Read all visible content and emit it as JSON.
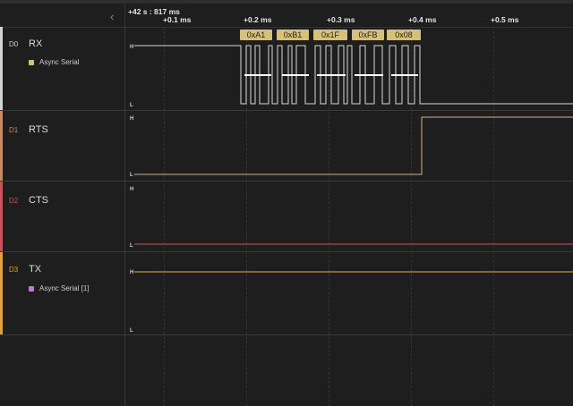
{
  "timeline": {
    "origin": "+42 s : 817 ms",
    "ticks": [
      "+0.1 ms",
      "+0.2 ms",
      "+0.3 ms",
      "+0.4 ms",
      "+0.5 ms"
    ]
  },
  "level_labels": {
    "high": "H",
    "low": "L"
  },
  "channels": [
    {
      "num": "D0",
      "name": "RX",
      "color": "#d4d4d4",
      "analyzer": "Async Serial",
      "analyzer_color": "#d5c07c",
      "decoded": [
        "0xA1",
        "0xB1",
        "0x1F",
        "0xFB",
        "0x08"
      ]
    },
    {
      "num": "D1",
      "name": "RTS",
      "color": "#c98a64"
    },
    {
      "num": "D2",
      "name": "CTS",
      "color": "#c8535c"
    },
    {
      "num": "D3",
      "name": "TX",
      "color": "#e0a240",
      "analyzer": "Async Serial [1]",
      "analyzer_color": "#c576d6"
    }
  ],
  "colors": {
    "rx_wave": "#d8d8d8",
    "rts_wave": "#d9b08a",
    "cts_wave": "#d0545c",
    "tx_wave": "#e2b25a",
    "decode_bubble": "#d5c07c"
  },
  "icons": {
    "collapse": "chevron-left-icon"
  }
}
